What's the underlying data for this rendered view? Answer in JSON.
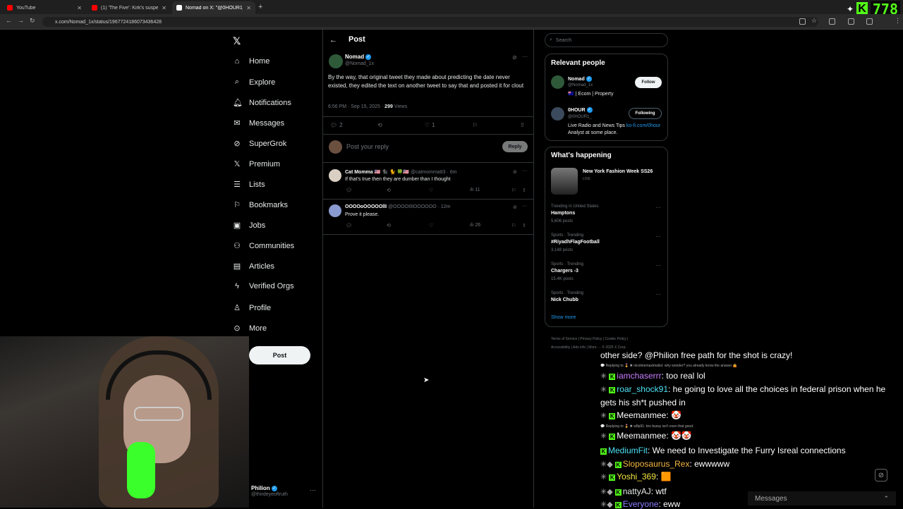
{
  "browser": {
    "tabs": [
      {
        "title": "YouTube",
        "color": "#ff0000"
      },
      {
        "title": "(1) 'The Five': Kirk's suspected a",
        "color": "#ff0000"
      },
      {
        "title": "Nomad on X: \"@0HOUR1_ By",
        "color": "#ffffff"
      }
    ],
    "url": "x.com/Nomad_1x/status/1967724186073436428",
    "kick_count": "778"
  },
  "nav": {
    "items": [
      "Home",
      "Explore",
      "Notifications",
      "Messages",
      "SuperGrok",
      "Premium",
      "Lists",
      "Bookmarks",
      "Jobs",
      "Communities",
      "Articles",
      "Verified Orgs",
      "Profile",
      "More"
    ],
    "post_label": "Post",
    "account_name": "Philion",
    "account_handle": "@thirdeyeoftruth"
  },
  "post": {
    "header": "Post",
    "author_name": "Nomad",
    "author_handle": "@Nomad_1x",
    "text": "By the way, that original tweet they made about predicting the date never existed, they edited the text on another tweet to say that and posted it for clout",
    "time": "6:56 PM · Sep 15, 2025 · ",
    "views_num": "299",
    "views_label": " Views",
    "replies": "2",
    "likes": "1",
    "reply_placeholder": "Post your reply",
    "reply_button": "Reply"
  },
  "replies": [
    {
      "name": "Cat Momma 🇺🇸 🐈‍⬛ 🐈 🍀🇺🇸",
      "meta": " @catmomma83 · 6m",
      "text": "If that's true then they are dumber than I thought",
      "views": "11"
    },
    {
      "name": "OOOOoOOOOOllI",
      "meta": " @OOOOIlIlOOOOOO · 12m",
      "text": "Prove it please.",
      "views": "26"
    }
  ],
  "right": {
    "search_placeholder": "Search",
    "relevant_title": "Relevant people",
    "people": [
      {
        "name": "Nomad",
        "handle": "@Nomad_1x",
        "bio": "🇦🇺 | Ecom | Property",
        "button": "Follow"
      },
      {
        "name": "0HOUR",
        "handle": "@0HOUR1_",
        "bio_pre": "Live Radio and News Tips ",
        "bio_link": "ko-fi.com/0hour",
        "bio_post": " Analyst at some place.",
        "button": "Following"
      }
    ],
    "happening_title": "What's happening",
    "event": {
      "title": "New York Fashion Week SS26",
      "status": "LIVE"
    },
    "trends": [
      {
        "cat": "Trending in United States",
        "title": "Hamptons",
        "count": "5,606 posts"
      },
      {
        "cat": "Sports · Trending",
        "title": "#RiyadhFlagFootball",
        "count": "3,148 posts"
      },
      {
        "cat": "Sports · Trending",
        "title": "Chargers -3",
        "count": "15.4K posts"
      },
      {
        "cat": "Sports · Trending",
        "title": "Nick Chubb",
        "count": ""
      }
    ],
    "show_more": "Show more",
    "footer_line1": "Terms of Service  |  Privacy Policy  |  Cookie Policy  |",
    "footer_line2": "Accessibility  |  Ads info  |  More ···  © 2025 X Corp."
  },
  "chat": {
    "line0": "other side? @Philion free path for the shot is crazy!",
    "reply1": "💬 Replying to 🎖️ ✖ nicotinemaximalist: why wonder? you already know the answer 🤷",
    "lines": [
      {
        "user": "iamchaserrr",
        "color": "#c77dff",
        "msg": ": too real lol"
      },
      {
        "user": "roar_shock91",
        "color": "#4de1f5",
        "msg": ": he going to love all the choices in federal prison when he"
      },
      {
        "user": "Meemanmee",
        "color": "#ffffff",
        "msg": ": 🤡"
      },
      {
        "user": "Meemanmee",
        "color": "#ffffff",
        "msg": ": 🤡🤡"
      },
      {
        "user": "MediumFit",
        "color": "#4de1f5",
        "msg": ": We need to Investigate the Furry Isreal connections"
      },
      {
        "user": "Sloposaurus_Rex",
        "color": "#f5b642",
        "msg": ": ewwwww"
      },
      {
        "user": "Yoshi_369",
        "color": "#f5e642",
        "msg": ": 🟧"
      },
      {
        "user": "nattyAJ",
        "color": "#e7e9ea",
        "msg": ": wtf"
      },
      {
        "user": "Everyone",
        "color": "#8a7dff",
        "msg": ": eww"
      }
    ],
    "wrap": "gets his sh*t pushed in",
    "reply2": "💬 Replying to 🎖️ ✖ w8p91: bro bussy isn't even that good.",
    "messages_label": "Messages"
  }
}
